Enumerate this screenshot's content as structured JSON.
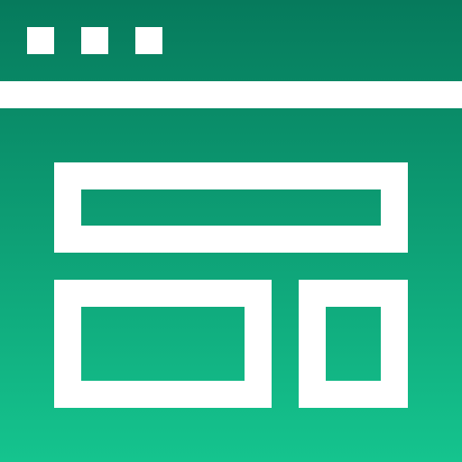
{
  "icon": {
    "name": "web-layout-icon",
    "colors": {
      "gradient_top": "#067A5C",
      "gradient_bottom": "#15C48E",
      "stroke": "#FFFFFF"
    }
  },
  "window": {
    "title_dots": 3
  },
  "layout_blocks": [
    {
      "name": "header-block"
    },
    {
      "name": "content-block-wide"
    },
    {
      "name": "content-block-narrow"
    }
  ]
}
